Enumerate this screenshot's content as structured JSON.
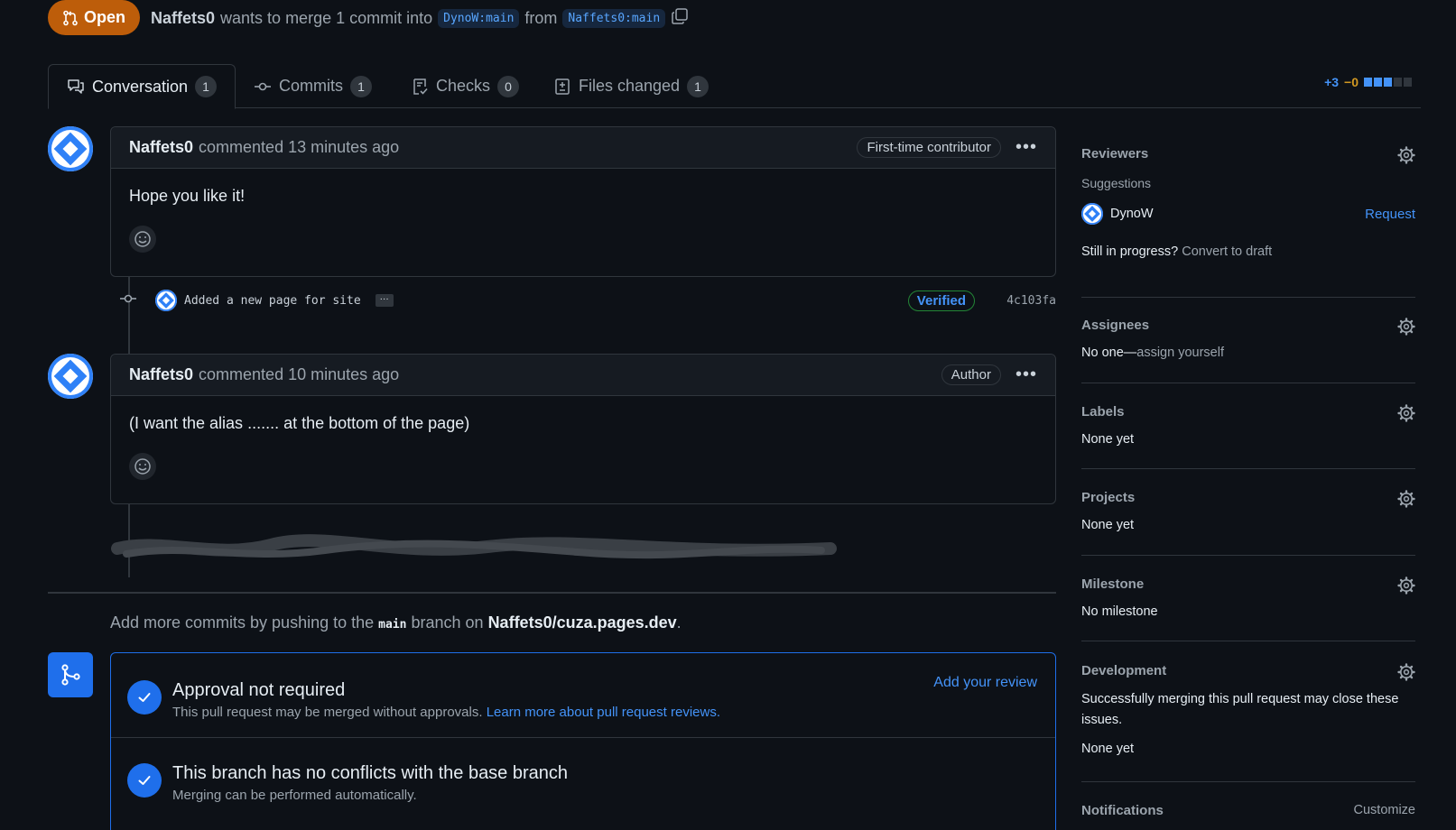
{
  "header": {
    "state": "Open",
    "author": "Naffets0",
    "text_merge": "wants to merge 1 commit into",
    "base_branch": "DynoW:main",
    "text_from": "from",
    "head_branch": "Naffets0:main"
  },
  "tabs": [
    {
      "label": "Conversation",
      "count": "1"
    },
    {
      "label": "Commits",
      "count": "1"
    },
    {
      "label": "Checks",
      "count": "0"
    },
    {
      "label": "Files changed",
      "count": "1"
    }
  ],
  "diffstat": {
    "additions": "+3",
    "deletions": "−0"
  },
  "comments": [
    {
      "author": "Naffets0",
      "meta": "commented 13 minutes ago",
      "badge": "First-time contributor",
      "body": "Hope you like it!"
    },
    {
      "author": "Naffets0",
      "meta": "commented 10 minutes ago",
      "badge": "Author",
      "body": "(I want the alias ....... at the bottom of the page)"
    }
  ],
  "commit": {
    "message": "Added a new page for site",
    "verified": "Verified",
    "sha": "4c103fa"
  },
  "push_hint": {
    "prefix": "Add more commits by pushing to the",
    "branch": "main",
    "middle": "branch on",
    "repo": "Naffets0/cuza.pages.dev",
    "suffix": "."
  },
  "merge": {
    "approval_title": "Approval not required",
    "approval_sub": "This pull request may be merged without approvals.",
    "approval_link": "Learn more about pull request reviews.",
    "add_review": "Add your review",
    "conflict_title": "This branch has no conflicts with the base branch",
    "conflict_sub": "Merging can be performed automatically."
  },
  "sidebar": {
    "reviewers": {
      "title": "Reviewers",
      "suggestions": "Suggestions",
      "suggested_user": "DynoW",
      "request": "Request",
      "draft_prefix": "Still in progress?",
      "draft_link": "Convert to draft"
    },
    "assignees": {
      "title": "Assignees",
      "prefix": "No one—",
      "link": "assign yourself"
    },
    "labels": {
      "title": "Labels",
      "value": "None yet"
    },
    "projects": {
      "title": "Projects",
      "value": "None yet"
    },
    "milestone": {
      "title": "Milestone",
      "value": "No milestone"
    },
    "development": {
      "title": "Development",
      "desc": "Successfully merging this pull request may close these issues.",
      "value": "None yet"
    },
    "notifications": {
      "title": "Notifications",
      "action": "Customize"
    }
  },
  "colors": {
    "accent": "#1f6feb",
    "open_badge": "#bd5d0a",
    "link": "#4493f8",
    "background": "#0d1117"
  }
}
